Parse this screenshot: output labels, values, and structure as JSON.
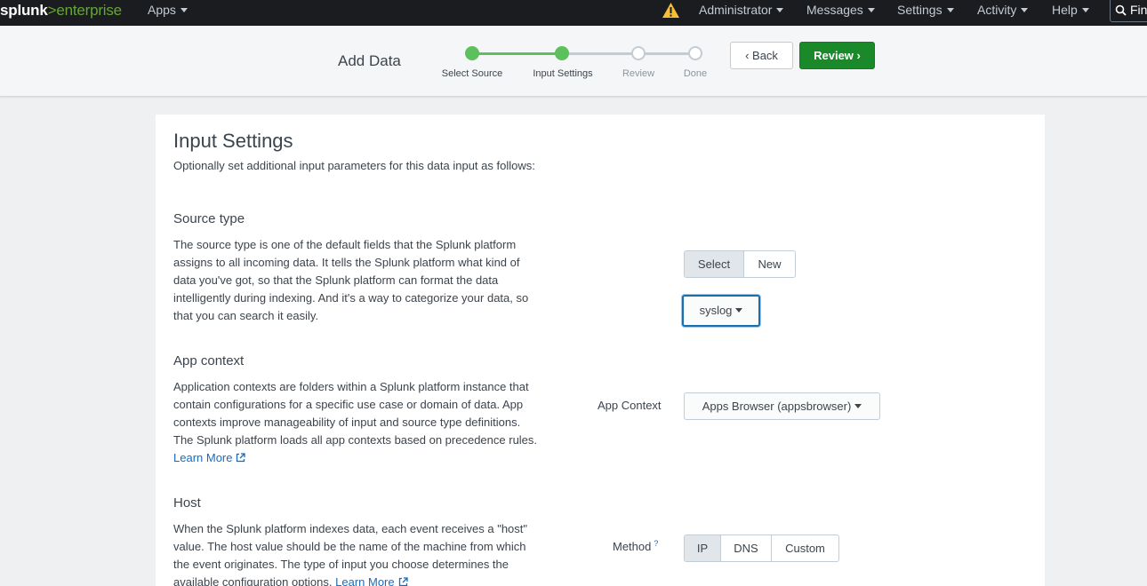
{
  "topnav": {
    "logo_main": "splunk",
    "logo_arrow": ">",
    "logo_product": "enterprise",
    "apps": "Apps",
    "administrator": "Administrator",
    "messages": "Messages",
    "settings": "Settings",
    "activity": "Activity",
    "help": "Help",
    "find": "Find"
  },
  "wizard": {
    "title": "Add Data",
    "steps": [
      {
        "label": "Select Source",
        "state": "done"
      },
      {
        "label": "Input Settings",
        "state": "current"
      },
      {
        "label": "Review",
        "state": "todo"
      },
      {
        "label": "Done",
        "state": "todo"
      }
    ],
    "back_label": "Back",
    "review_label": "Review"
  },
  "panel": {
    "title": "Input Settings",
    "subtitle": "Optionally set additional input parameters for this data input as follows:",
    "source_type": {
      "title": "Source type",
      "description": "The source type is one of the default fields that the Splunk platform assigns to all incoming data. It tells the Splunk platform what kind of data you've got, so that the Splunk platform can format the data intelligently during indexing. And it's a way to categorize your data, so that you can search it easily.",
      "mode_options": [
        "Select",
        "New"
      ],
      "mode_selected": "Select",
      "value": "syslog"
    },
    "app_context": {
      "title": "App context",
      "description": "Application contexts are folders within a Splunk platform instance that contain configurations for a specific use case or domain of data. App contexts improve manageability of input and source type definitions. The Splunk platform loads all app contexts based on precedence rules.",
      "learn_more": "Learn More",
      "field_label": "App Context",
      "value": "Apps Browser (appsbrowser)"
    },
    "host": {
      "title": "Host",
      "description": "When the Splunk platform indexes data, each event receives a \"host\" value. The host value should be the name of the machine from which the event originates. The type of input you choose determines the available configuration options.",
      "learn_more": "Learn More",
      "field_label": "Method",
      "help_mark": "?",
      "options": [
        "IP",
        "DNS",
        "Custom"
      ],
      "selected": "IP"
    }
  },
  "colors": {
    "nav_bg": "#1a1c20",
    "brand_green": "#65a637",
    "step_done": "#5cc05c",
    "primary_button": "#1a8929",
    "link": "#1a6bbd",
    "focus": "#1a6fad"
  }
}
